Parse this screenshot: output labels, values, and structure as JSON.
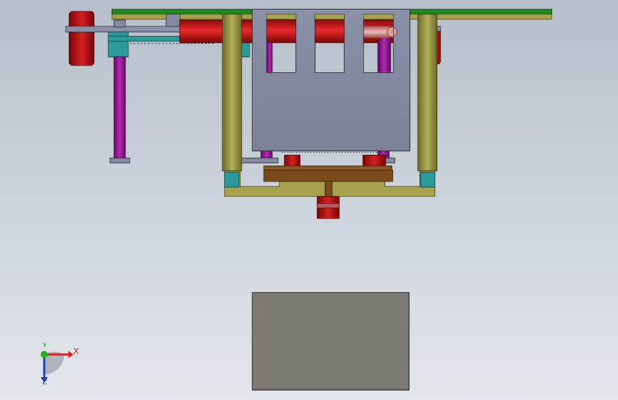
{
  "viewport": {
    "background_top": "#b8c0cb",
    "background_bottom": "#e2e6ec"
  },
  "colors": {
    "green_plate": "#1e8a1e",
    "olive": "#a6a24e",
    "olive_dark": "#6f6c2a",
    "red_cylinder": "#c81818",
    "red_dark": "#7a0808",
    "purple_rod": "#a020a0",
    "teal": "#2a9a9a",
    "grey_plate": "#858aa0",
    "steel": "#8890a0",
    "brown_beam": "#7a4a1c",
    "base_box": "#7d7a74",
    "pink": "#e0a0a0"
  },
  "triad": {
    "x_label": "X",
    "y_label": "Y",
    "z_label": "Z",
    "x_color": "#e02020",
    "y_color": "#20b020",
    "z_color": "#2040c0"
  }
}
